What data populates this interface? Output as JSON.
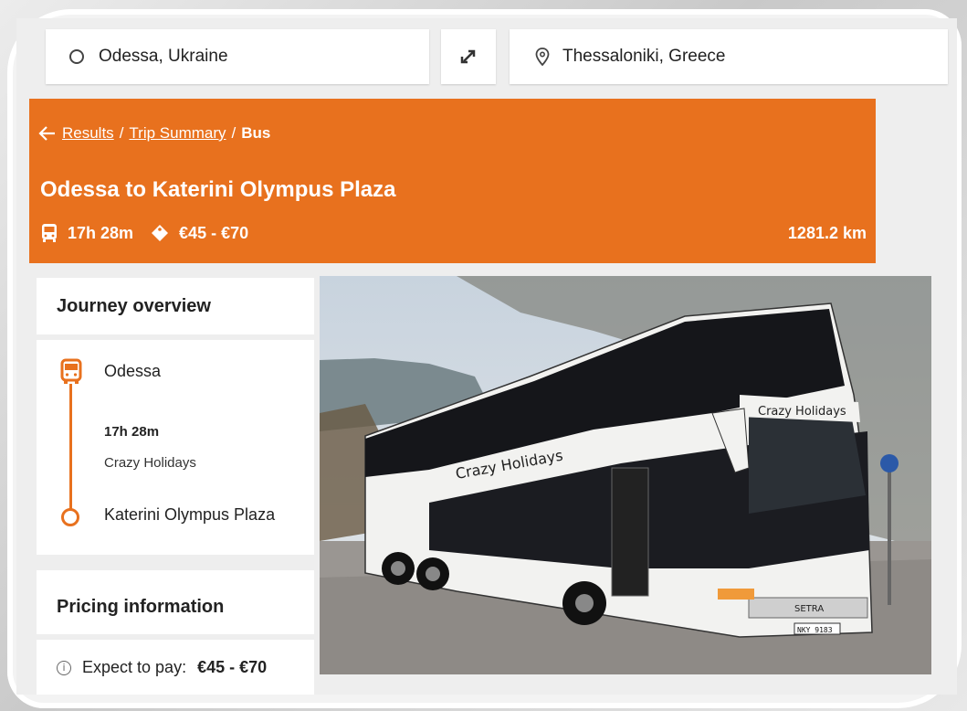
{
  "search": {
    "origin": "Odessa, Ukraine",
    "destination": "Thessaloniki, Greece"
  },
  "header": {
    "breadcrumb": {
      "results": "Results",
      "sep1": "/",
      "trip_summary": "Trip Summary",
      "sep2": "/",
      "current": "Bus"
    },
    "title": "Odessa to Katerini Olympus Plaza",
    "duration": "17h 28m",
    "price_range": "€45 - €70",
    "distance": "1281.2 km"
  },
  "journey": {
    "heading": "Journey overview",
    "origin": "Odessa",
    "duration": "17h 28m",
    "operator": "Crazy Holidays",
    "destination": "Katerini Olympus Plaza"
  },
  "pricing": {
    "heading": "Pricing information",
    "label": "Expect to pay:",
    "value": "€45 - €70"
  },
  "photo": {
    "bus_livery_text": "Crazy Holidays",
    "plate": "NKY 9183",
    "badge": "SETRA"
  },
  "colors": {
    "accent": "#e8711e"
  },
  "icons": [
    "circle-origin-icon",
    "swap-icon",
    "location-pin-icon",
    "back-arrow-icon",
    "bus-icon",
    "price-tag-icon",
    "info-icon"
  ]
}
